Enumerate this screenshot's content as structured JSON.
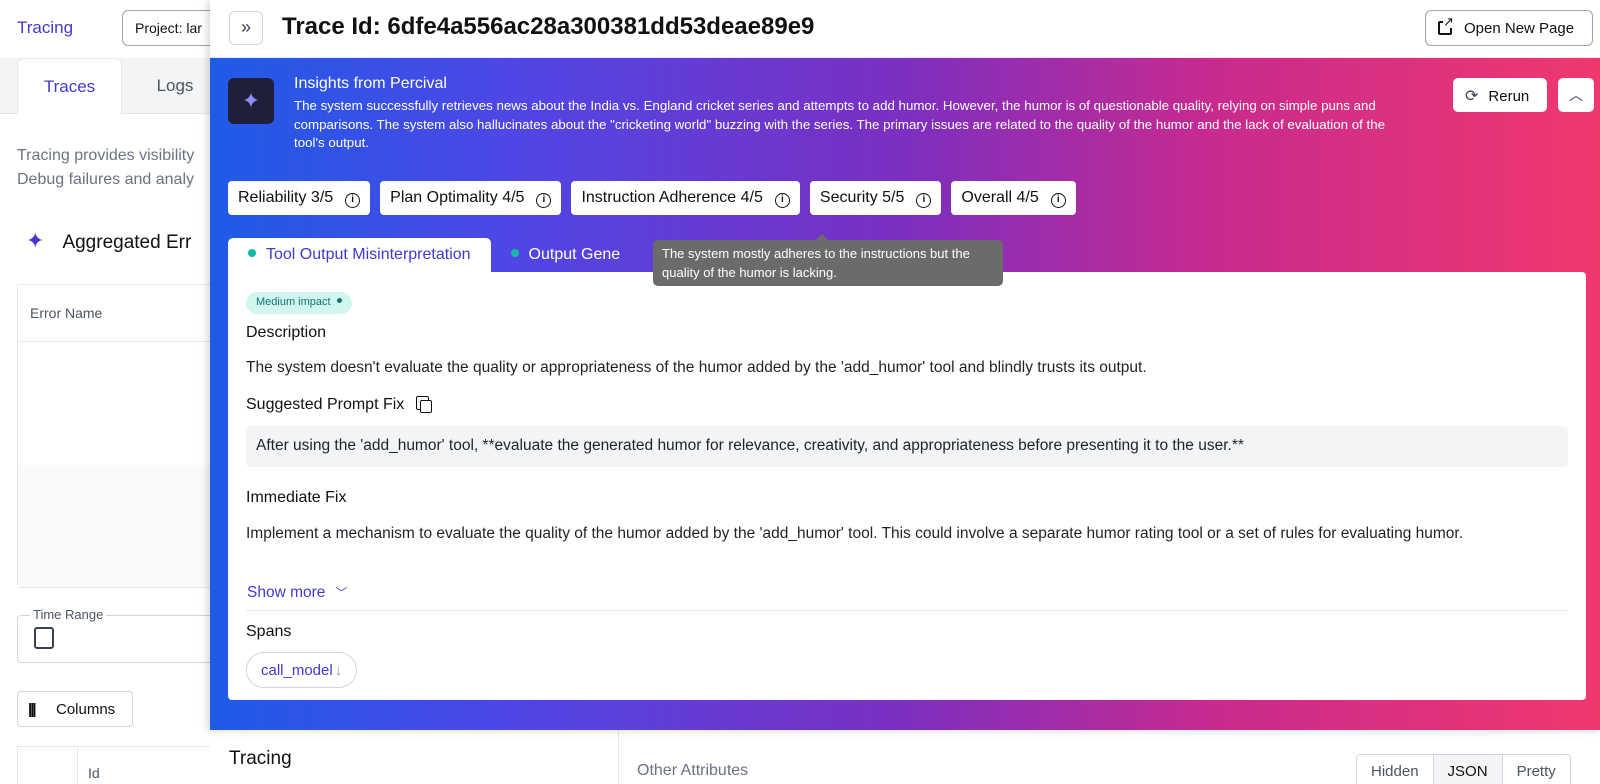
{
  "background": {
    "app_title": "Tracing",
    "project_selector": "Project: lar",
    "tabs": [
      "Traces",
      "Logs"
    ],
    "description_line1": "Tracing provides visibility",
    "description_line2": "Debug failures and analy",
    "aggregated_title": "Aggregated Err",
    "error_table_header": "Error Name",
    "time_range_label": "Time Range",
    "columns_button": "Columns",
    "id_column_header": "Id",
    "bottom_tracing_title": "Tracing",
    "other_attributes_label": "Other Attributes",
    "view_modes": [
      "Hidden",
      "JSON",
      "Pretty"
    ],
    "selected_view_mode": "JSON"
  },
  "drawer": {
    "collapse_icon": "»",
    "trace_title": "Trace Id: 6dfe4a556ac28a300381dd53deae89e9",
    "open_new_page_label": "Open New Page",
    "insights": {
      "title": "Insights from Percival",
      "text": "The system successfully retrieves news about the India vs. England cricket series and attempts to add humor. However, the humor is of questionable quality, relying on simple puns and comparisons. The system also hallucinates about the \"cricketing world\" buzzing with the series. The primary issues are related to the quality of the humor and the lack of evaluation of the tool's output.",
      "rerun_label": "Rerun"
    },
    "scores": [
      "Reliability 3/5",
      "Plan Optimality 4/5",
      "Instruction Adherence 4/5",
      "Security 5/5",
      "Overall 4/5"
    ],
    "tooltip": "The system mostly adheres to the instructions but the quality of the humor is lacking.",
    "tabs": [
      "Tool Output Misinterpretation",
      "Output Gene"
    ],
    "issue": {
      "impact_badge": "Medium impact",
      "description_heading": "Description",
      "description_text": "The system doesn't evaluate the quality or appropriateness of the humor added by the 'add_humor' tool and blindly trusts its output.",
      "prompt_fix_heading": "Suggested Prompt Fix",
      "prompt_fix_text": "After using the 'add_humor' tool, **evaluate the generated humor for relevance, creativity, and appropriateness before presenting it to the user.**",
      "immediate_fix_heading": "Immediate Fix",
      "immediate_fix_text": "Implement a mechanism to evaluate the quality of the humor added by the 'add_humor' tool. This could involve a separate humor rating tool or a set of rules for evaluating humor.",
      "show_more_label": "Show more",
      "spans_heading": "Spans",
      "span_chip": "call_model"
    }
  },
  "colors": {
    "accent": "#4338ca",
    "gradient_start": "#1e5be6",
    "gradient_mid": "#7c2fc0",
    "gradient_end": "#f0386e",
    "badge_teal": "#0f766e"
  }
}
